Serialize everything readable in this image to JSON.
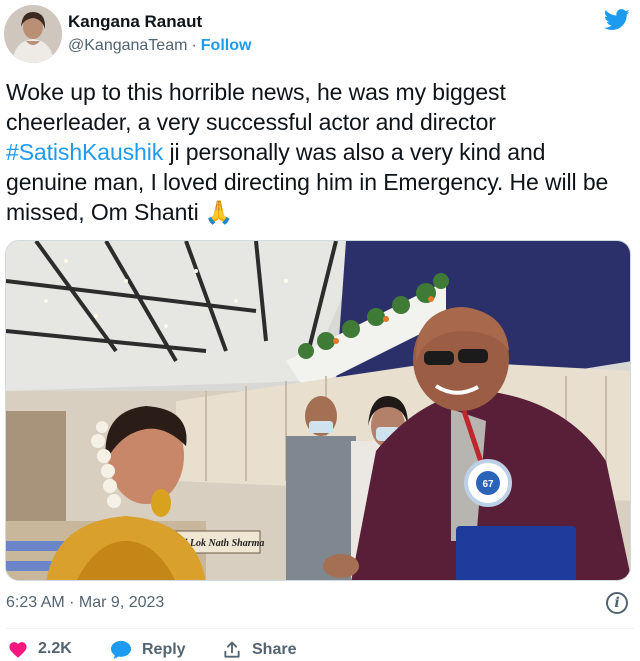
{
  "author": {
    "display_name": "Kangana Ranaut",
    "handle": "@KanganaTeam",
    "separator": "·",
    "follow_label": "Follow"
  },
  "tweet": {
    "text_before": "Woke up to this horrible news, he was my biggest cheerleader, a very successful actor and director ",
    "hashtag": "#SatishKaushik",
    "text_after": " ji personally was also a very kind and genuine man, I loved directing him in Emergency. He will be missed, Om Shanti 🙏",
    "timestamp": "6:23 AM · Mar 9, 2023"
  },
  "photo": {
    "nameplate_text": "Shri Lok Nath Sharma",
    "badge_text": "67"
  },
  "actions": {
    "likes_count": "2.2K",
    "reply_label": "Reply",
    "share_label": "Share"
  },
  "colors": {
    "accent": "#1d9bf0",
    "like": "#f91880",
    "muted": "#536471"
  },
  "icons": {
    "brand": "twitter-bird-icon",
    "info": "info-icon",
    "like": "heart-icon",
    "reply": "reply-bubble-icon",
    "share": "share-upload-icon"
  }
}
